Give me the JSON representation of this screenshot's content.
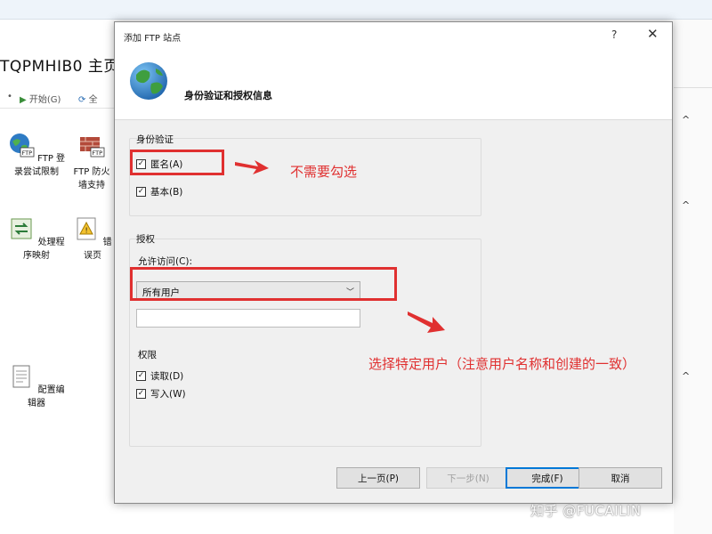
{
  "background": {
    "title": "TQPMHIB0 主页",
    "toolbar": {
      "start": "开始(G)",
      "all": "全"
    },
    "features": [
      {
        "label": "FTP 登录尝试限制"
      },
      {
        "label": "FTP 防火墙支持"
      },
      {
        "label": "处理程序映射"
      },
      {
        "label": "错误页"
      },
      {
        "label": "配置编辑器"
      }
    ],
    "right_caret": "^"
  },
  "dialog": {
    "title": "添加 FTP 站点",
    "help": "?",
    "close": "✕",
    "heading": "身份验证和授权信息",
    "auth": {
      "group_label": "身份验证",
      "anonymous": {
        "label": "匿名(A)",
        "checked": true
      },
      "basic": {
        "label": "基本(B)",
        "checked": true
      }
    },
    "authorization": {
      "group_label": "授权",
      "allow_access_label": "允许访问(C):",
      "allow_access_value": "所有用户",
      "text_value": "",
      "permissions_label": "权限",
      "read": {
        "label": "读取(D)",
        "checked": true
      },
      "write": {
        "label": "写入(W)",
        "checked": true
      }
    },
    "buttons": {
      "prev": "上一页(P)",
      "next": "下一步(N)",
      "finish": "完成(F)",
      "cancel": "取消"
    }
  },
  "annotations": {
    "no_check": "不需要勾选",
    "select_user": "选择特定用户（注意用户名称和创建的一致）"
  },
  "watermark": "知乎 @FUCAILIN",
  "colors": {
    "annotation_red": "#e03030",
    "accent_blue": "#0078d7",
    "dialog_bg": "#f0f0f0"
  },
  "icons": {
    "dialog_header": "globe-icon",
    "checkbox_mark": "✓",
    "dropdown": "chevron-down-icon"
  }
}
